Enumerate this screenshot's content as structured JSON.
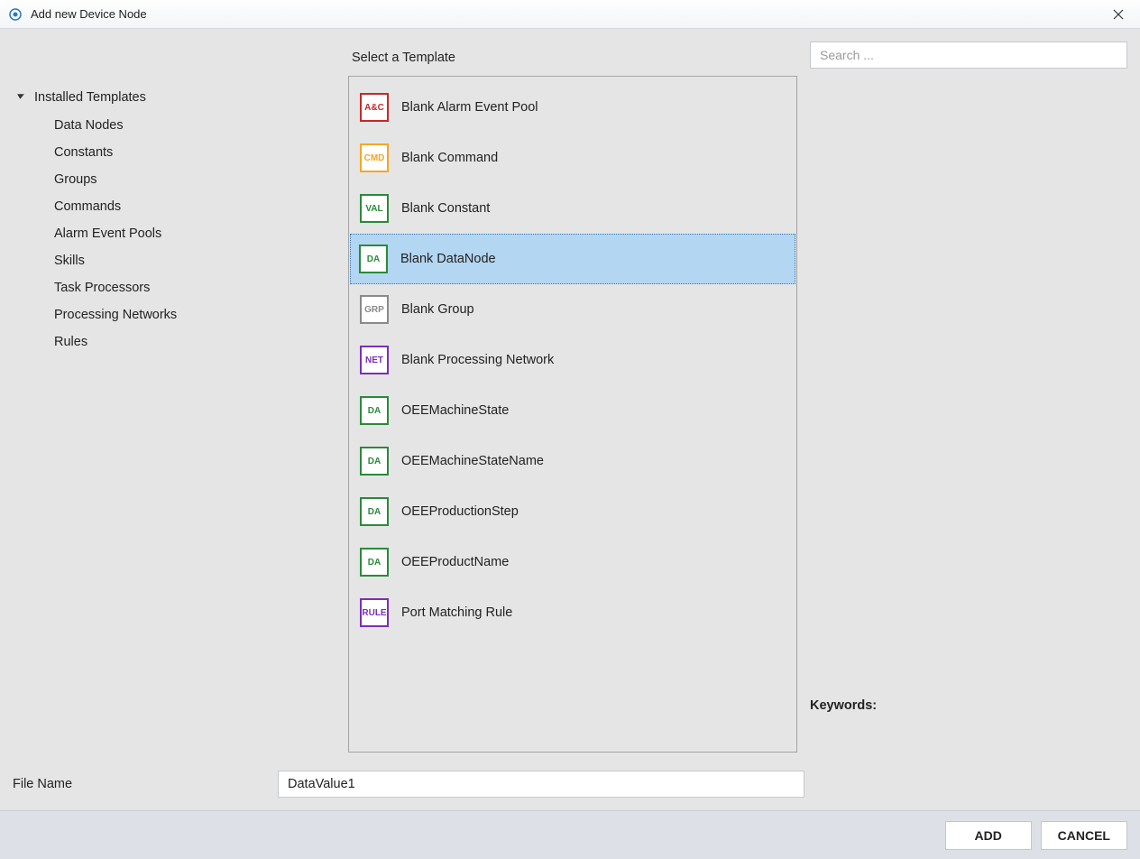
{
  "titlebar": {
    "title": "Add new Device Node"
  },
  "sidebar": {
    "root_label": "Installed Templates",
    "items": [
      "Data Nodes",
      "Constants",
      "Groups",
      "Commands",
      "Alarm Event Pools",
      "Skills",
      "Task Processors",
      "Processing Networks",
      "Rules"
    ]
  },
  "center": {
    "header": "Select a Template",
    "templates": [
      {
        "abbr": "A&C",
        "color": "#c62828",
        "label": "Blank Alarm Event Pool",
        "selected": false
      },
      {
        "abbr": "CMD",
        "color": "#f5a623",
        "label": "Blank Command",
        "selected": false
      },
      {
        "abbr": "VAL",
        "color": "#2a8a3a",
        "label": "Blank Constant",
        "selected": false
      },
      {
        "abbr": "DA",
        "color": "#2a8a3a",
        "label": "Blank DataNode",
        "selected": true
      },
      {
        "abbr": "GRP",
        "color": "#8a8a8a",
        "label": "Blank Group",
        "selected": false
      },
      {
        "abbr": "NET",
        "color": "#7b2fb5",
        "label": "Blank Processing Network",
        "selected": false
      },
      {
        "abbr": "DA",
        "color": "#2a8a3a",
        "label": "OEEMachineState",
        "selected": false
      },
      {
        "abbr": "DA",
        "color": "#2a8a3a",
        "label": "OEEMachineStateName",
        "selected": false
      },
      {
        "abbr": "DA",
        "color": "#2a8a3a",
        "label": "OEEProductionStep",
        "selected": false
      },
      {
        "abbr": "DA",
        "color": "#2a8a3a",
        "label": "OEEProductName",
        "selected": false
      },
      {
        "abbr": "RULE",
        "color": "#7b2fb5",
        "label": "Port Matching Rule",
        "selected": false
      }
    ]
  },
  "right": {
    "search_placeholder": "Search ...",
    "keywords_label": "Keywords:"
  },
  "filename": {
    "label": "File Name",
    "value": "DataValue1"
  },
  "footer": {
    "add_label": "ADD",
    "cancel_label": "CANCEL"
  }
}
